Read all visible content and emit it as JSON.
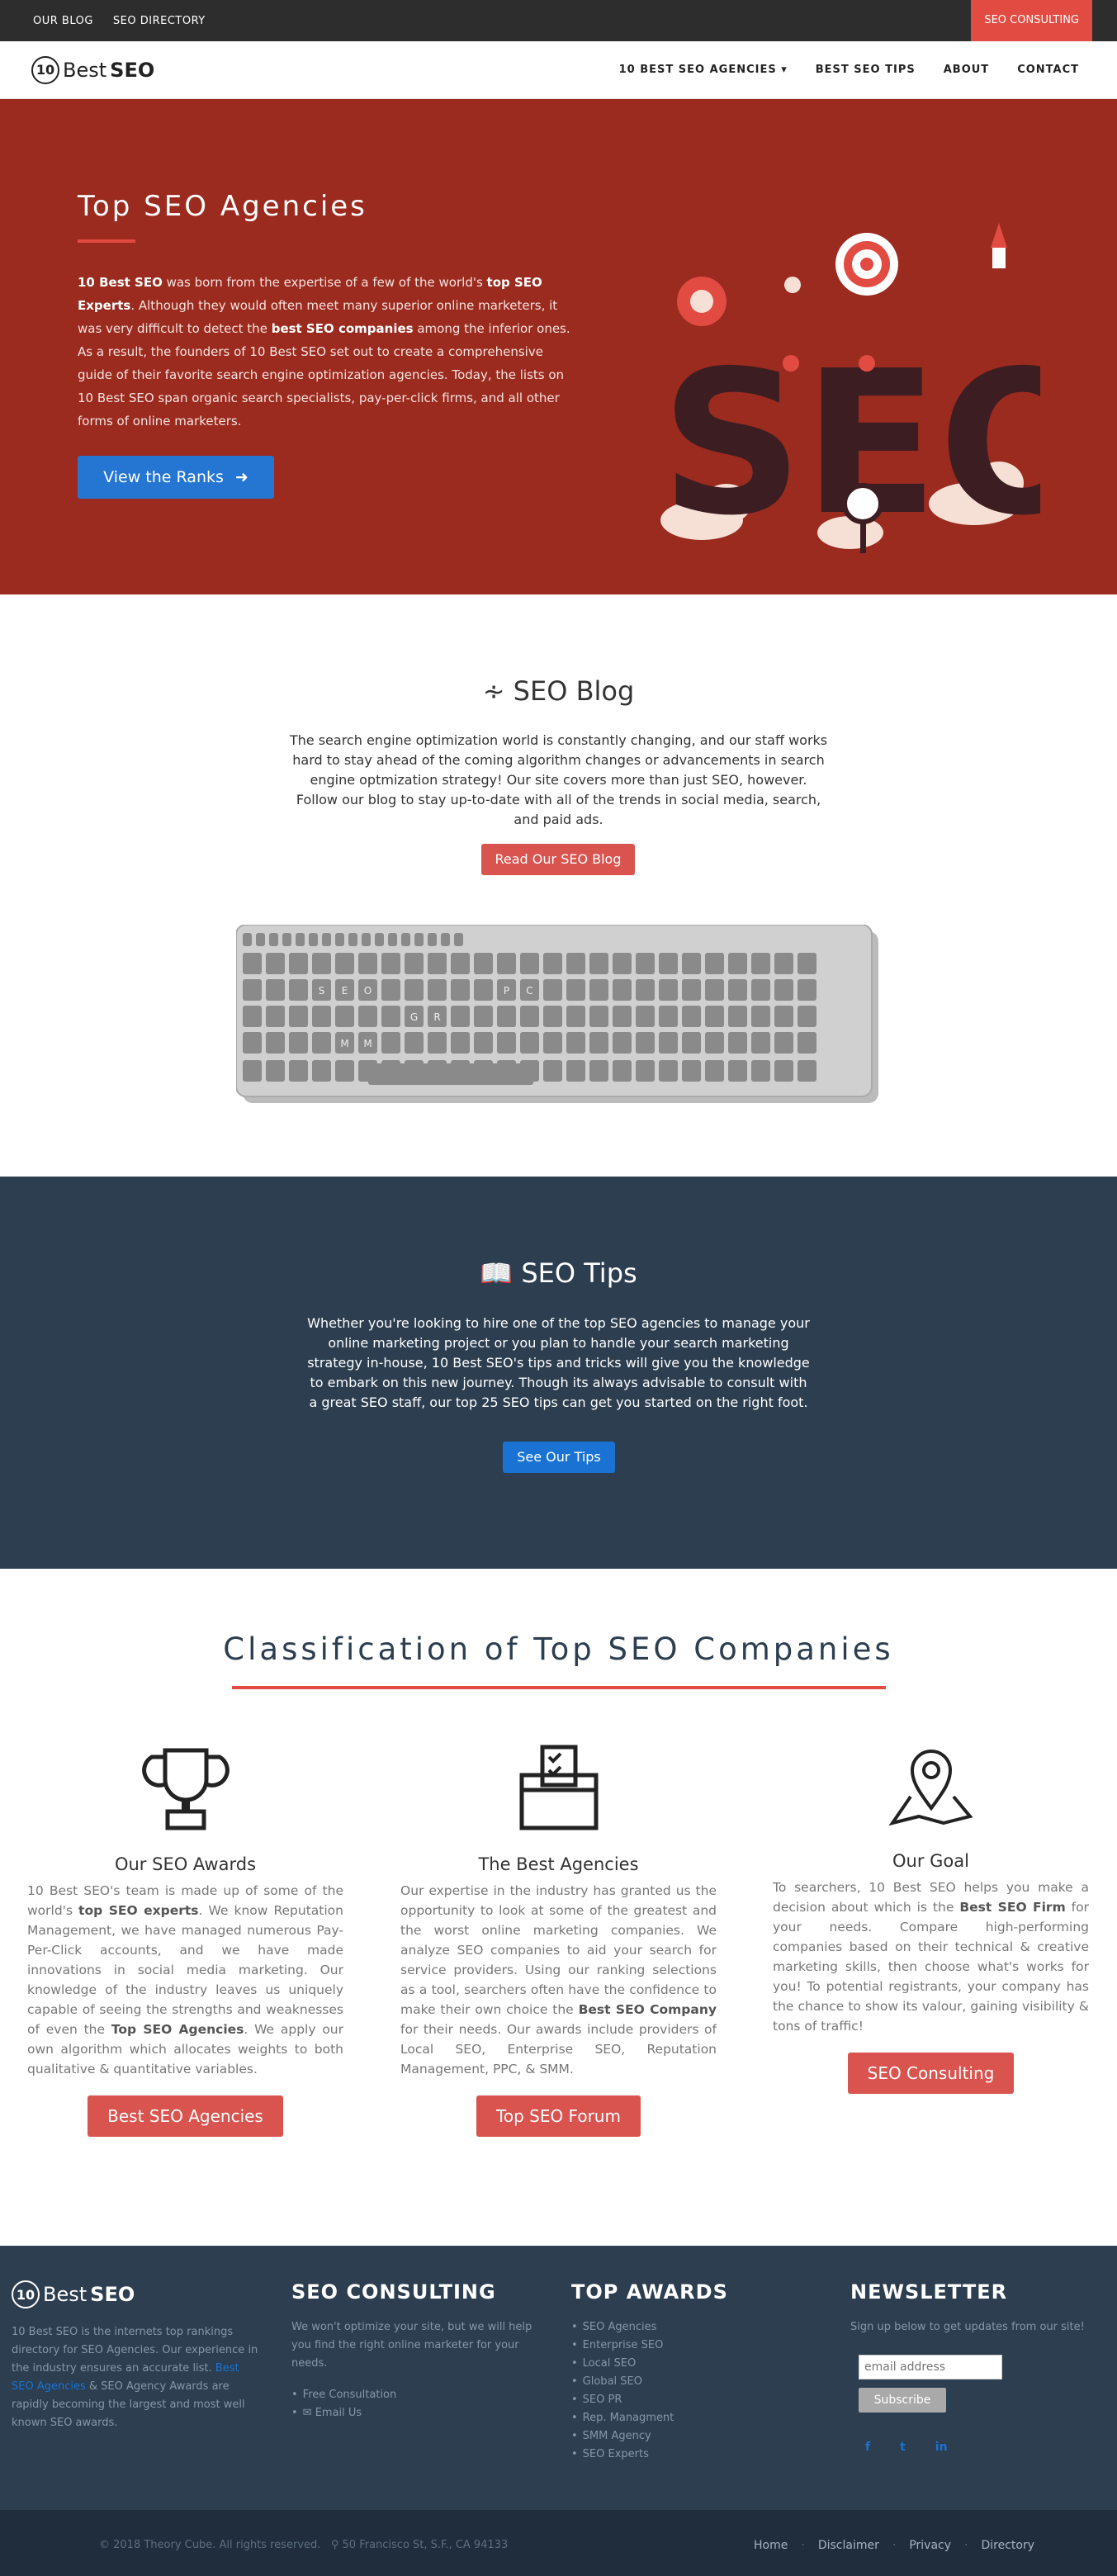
{
  "topbar": {
    "links": [
      "OUR BLOG",
      "SEO DIRECTORY"
    ],
    "cta": "SEO CONSULTING"
  },
  "logo": {
    "number": "10",
    "text_a": "Best",
    "text_b": "SEO"
  },
  "nav": {
    "items": [
      "10 BEST SEO AGENCIES ▾",
      "BEST SEO TIPS",
      "ABOUT",
      "CONTACT"
    ]
  },
  "hero": {
    "title": "Top SEO Agencies",
    "p1": "10 Best SEO",
    "p2": " was born from the expertise of a few of the world's ",
    "p3": "top SEO Experts",
    "p4": ". Although they would often meet many superior online marketers, it was very difficult to detect the ",
    "p5": "best SEO companies",
    "p6": " among the inferior ones. As a result, the founders of 10 Best SEO set out to create a comprehensive guide of their favorite search engine optimization agencies. Today, the lists on 10 Best SEO span organic search specialists, pay-per-click firms, and all other forms of online marketers.",
    "button": "View the Ranks",
    "art_letters": "SEO"
  },
  "blog": {
    "title": "SEO Blog",
    "text": "The search engine optimization world is constantly changing, and our staff works hard to stay ahead of the coming algorithm changes or advancements in search engine optmization strategy! Our site covers more than just SEO, however. Follow our blog to stay up-to-date with all of the trends in social media, search, and paid ads.",
    "button": "Read Our SEO Blog",
    "keys": [
      "S",
      "E",
      "O",
      "G",
      "R",
      "P",
      "C",
      "S",
      "M",
      "M"
    ]
  },
  "tips": {
    "title": "SEO Tips",
    "text": "Whether you're looking to hire one of the top SEO agencies to manage your online marketing project or you plan to handle your search marketing strategy in-house, 10 Best SEO's tips and tricks will give you the knowledge to embark on this new journey. Though its always advisable to consult with a great SEO staff, our top 25 SEO tips can get you started on the right foot.",
    "button": "See Our Tips"
  },
  "classification": {
    "title": "Classification of Top SEO Companies",
    "cols": [
      {
        "title": "Our SEO Awards",
        "t1": "10 Best SEO's team is made up of some of the world's ",
        "b1": "top SEO experts",
        "t2": ". We know Reputation Management, we have managed numerous Pay-Per-Click accounts, and we have made innovations in social media marketing. Our knowledge of the industry leaves us uniquely capable of seeing the strengths and weaknesses of even the ",
        "b2": "Top SEO Agencies",
        "t3": ". We apply our own algorithm which allocates weights to both qualitative & quantitative variables.",
        "button": "Best SEO Agencies"
      },
      {
        "title": "The Best Agencies",
        "t1": "Our expertise in the industry has granted us the opportunity to look at some of the greatest and the worst online marketing companies. We analyze SEO companies to aid your search for service providers. Using our ranking selections as a tool, searchers often have the confidence to make their own choice the ",
        "b1": "Best SEO Company",
        "t2": " for their needs. Our awards include providers of Local SEO, Enterprise SEO, Reputation Management, PPC, & SMM.",
        "button": "Top SEO Forum"
      },
      {
        "title": "Our Goal",
        "t1": "To searchers, 10 Best SEO helps you make a decision about which is the ",
        "b1": "Best SEO Firm",
        "t2": " for your needs. Compare high-performing companies based on their technical & creative marketing skills, then choose what's works for you! To potential registrants, your company has the chance to show its valour, gaining visibility & tons of traffic!",
        "button": "SEO Consulting"
      }
    ]
  },
  "footer": {
    "about_t1": "10 Best SEO is the internets top rankings directory for SEO Agencies. Our experience in the industry ensures an accurate list. ",
    "about_link": "Best SEO Agencies",
    "about_t2": " & SEO Agency Awards are rapidly becoming the largest and most well known SEO awards.",
    "consult": {
      "title": "SEO CONSULTING",
      "text": "We won't optimize your site, but we will help you find the right online marketer for your needs.",
      "items": [
        "Free Consultation",
        "✉ Email Us"
      ]
    },
    "awards": {
      "title": "TOP AWARDS",
      "items": [
        "SEO Agencies",
        "Enterprise SEO",
        "Local SEO",
        "Global SEO",
        "SEO PR",
        "Rep. Managment",
        "SMM Agency",
        "SEO Experts"
      ]
    },
    "newsletter": {
      "title": "NEWSLETTER",
      "text": "Sign up below to get updates from our site!",
      "placeholder": "email address",
      "button": "Subscribe",
      "social": [
        "f",
        "t",
        "in"
      ]
    },
    "copyright": "© 2018 Theory Cube. All rights reserved.",
    "address": "50 Francisco St, S.F., CA 94133",
    "links": [
      "Home",
      "Disclaimer",
      "Privacy",
      "Directory"
    ]
  },
  "colors": {
    "accent": "#e24b42",
    "hero_bg": "#9b2a1f",
    "dark": "#2c3e50",
    "blue": "#1a73d3"
  }
}
